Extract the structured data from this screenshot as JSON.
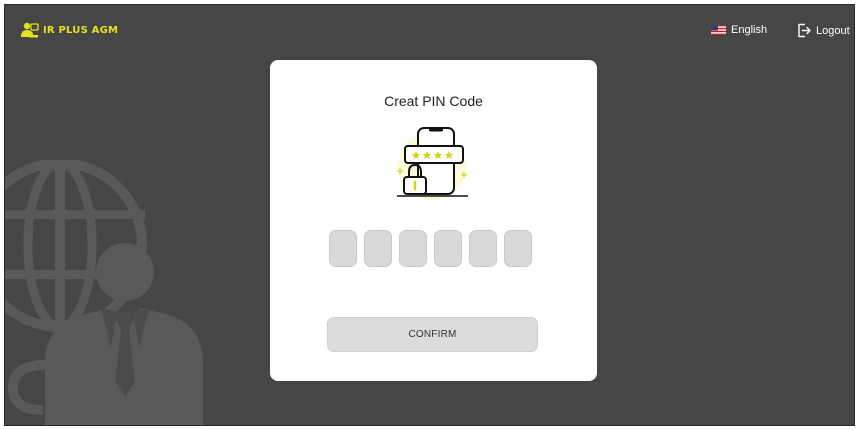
{
  "header": {
    "logo_text": "IR PLUS AGM",
    "logo_icon": "presenter-icon",
    "language_label": "English",
    "language_icon": "us-flag-icon",
    "logout_label": "Logout",
    "logout_icon": "logout-icon"
  },
  "colors": {
    "brand_accent": "#e4e21c",
    "background": "#464646",
    "card": "#ffffff",
    "pin_box": "#d9d9d9",
    "button": "#dcdcdc"
  },
  "modal": {
    "title": "Creat PIN Code",
    "illustration_icon": "phone-pin-lock-icon",
    "pin_length": 6,
    "confirm_label": "CONFIRM"
  },
  "background_art": "globe-businessman-icon"
}
